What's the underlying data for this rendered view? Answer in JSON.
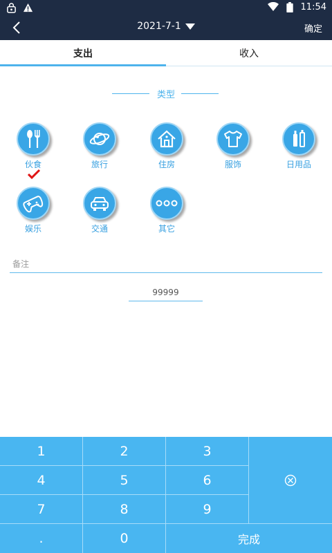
{
  "status_bar": {
    "time": "11:54",
    "icons": [
      "lock-icon",
      "warning-icon",
      "wifi-icon",
      "battery-icon"
    ]
  },
  "header": {
    "date": "2021-7-1",
    "confirm_label": "确定"
  },
  "tabs": [
    {
      "label": "支出",
      "active": true
    },
    {
      "label": "收入",
      "active": false
    }
  ],
  "section": {
    "title": "类型"
  },
  "categories": [
    {
      "label": "伙食",
      "icon": "utensils-icon",
      "selected": true
    },
    {
      "label": "旅行",
      "icon": "planet-icon",
      "selected": false
    },
    {
      "label": "住房",
      "icon": "house-icon",
      "selected": false
    },
    {
      "label": "服饰",
      "icon": "tshirt-icon",
      "selected": false
    },
    {
      "label": "日用品",
      "icon": "bottles-icon",
      "selected": false
    },
    {
      "label": "娱乐",
      "icon": "gamepad-icon",
      "selected": false
    },
    {
      "label": "交通",
      "icon": "car-icon",
      "selected": false
    },
    {
      "label": "其它",
      "icon": "more-icon",
      "selected": false
    }
  ],
  "remark": {
    "placeholder": "备注",
    "value": ""
  },
  "amount": {
    "value": "99999"
  },
  "keypad": {
    "keys": [
      "1",
      "2",
      "3",
      "4",
      "5",
      "6",
      "7",
      "8",
      "9",
      ".",
      "0"
    ],
    "delete_icon": "backspace-icon",
    "done_label": "完成"
  },
  "colors": {
    "header_bg": "#1e2c44",
    "accent": "#4db3ec",
    "icon_bg": "#39a6e6",
    "keypad_bg": "#49b6f1"
  }
}
